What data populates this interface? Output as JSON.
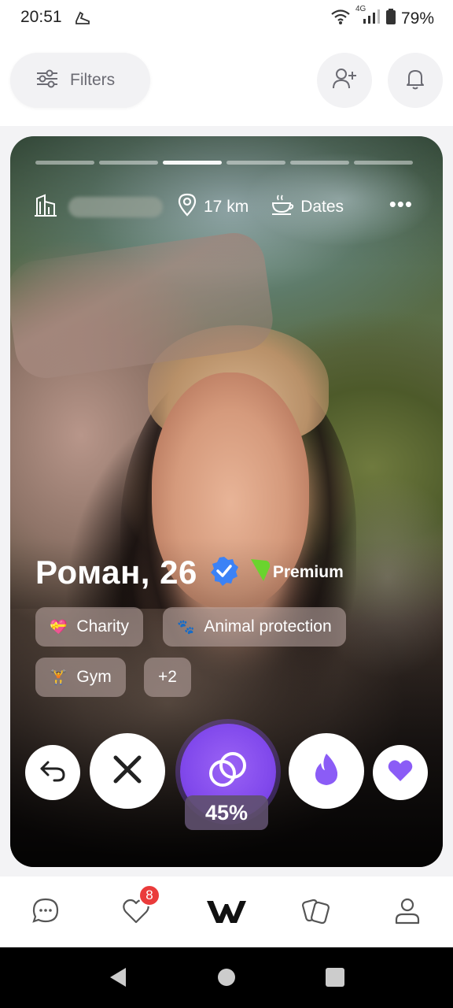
{
  "status_bar": {
    "time": "20:51",
    "network": "4G",
    "battery": "79%"
  },
  "top_bar": {
    "filters_label": "Filters"
  },
  "profile": {
    "distance": "17 km",
    "goal": "Dates",
    "name_age": "Роман, 26",
    "premium_label": "Premium",
    "photo_count": 6,
    "photo_active_index": 2,
    "interests": [
      {
        "emoji": "💝",
        "label": "Charity"
      },
      {
        "emoji": "🐾",
        "label": "Animal protection"
      },
      {
        "emoji": "🏋",
        "label": "Gym"
      },
      {
        "emoji": "",
        "label": "+2"
      }
    ],
    "match_percent": "45%"
  },
  "nav": {
    "likes_badge": "8"
  },
  "colors": {
    "accent": "#8149ec",
    "badge": "#ea3b3b",
    "verified": "#3b82f6",
    "premium": "#6ad42e"
  }
}
